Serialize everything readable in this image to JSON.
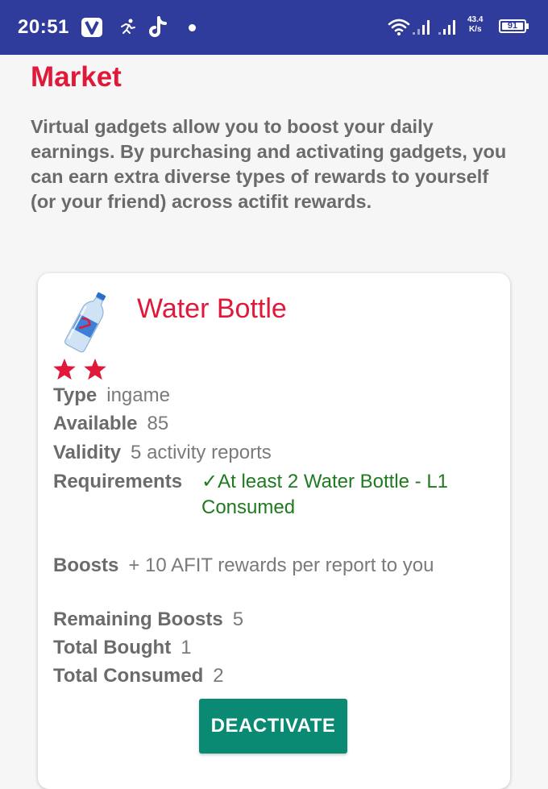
{
  "status_bar": {
    "time": "20:51",
    "speed_value": "43.4",
    "speed_unit": "K/s",
    "battery": "91"
  },
  "page": {
    "title": "Market",
    "intro": "Virtual gadgets allow you to boost your daily earnings. By purchasing and activating gadgets, you can earn extra diverse types of rewards to yourself (or your friend) across actifit rewards."
  },
  "gadget": {
    "name": "Water Bottle",
    "stars": 2,
    "type_label": "Type",
    "type_value": "ingame",
    "available_label": "Available",
    "available_value": "85",
    "validity_label": "Validity",
    "validity_value": "5 activity reports",
    "requirements_label": "Requirements",
    "requirements_value": "✓At least 2 Water Bottle - L1 Consumed",
    "boosts_label": "Boosts",
    "boosts_value": "+ 10 AFIT rewards per report to you",
    "remaining_label": "Remaining Boosts",
    "remaining_value": "5",
    "bought_label": "Total Bought",
    "bought_value": "1",
    "consumed_label": "Total Consumed",
    "consumed_value": "2",
    "button_label": "DEACTIVATE"
  },
  "colors": {
    "status_bar": "#2f3c9b",
    "accent_red": "#e0193a",
    "requirement_green": "#1f7a1f",
    "button_teal": "#0b8a73"
  }
}
